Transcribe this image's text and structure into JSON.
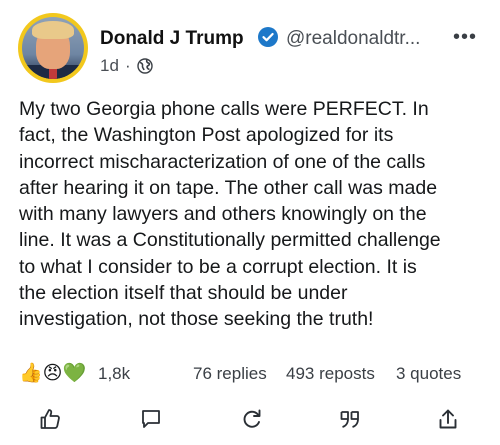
{
  "post": {
    "author": {
      "name": "Donald J Trump",
      "handle": "@realdonaldtr...",
      "verified": true,
      "avatar_icon": "avatar-portrait"
    },
    "time": "1d",
    "separator": "·",
    "visibility_icon": "globe-icon",
    "more_label": "•••",
    "body_lines": [
      "My two Georgia phone calls were PERFECT. In",
      "fact, the Washington Post apologized for its",
      "incorrect mischaracterization of one of the calls",
      "after hearing it on tape. The other call was made",
      "with many lawyers and others knowingly on the",
      "line. It was a Constitutionally permitted challenge",
      "to what I consider to be a corrupt election. It is",
      "the election itself that should be under",
      "investigation, not those seeking the truth!"
    ],
    "reactions": {
      "emojis": [
        "👍",
        "😠",
        "💚"
      ],
      "count": "1,8k"
    },
    "stats": {
      "replies": "76 replies",
      "reposts": "493 reposts",
      "quotes": "3 quotes"
    },
    "actions": [
      "like-icon",
      "comment-icon",
      "repost-icon",
      "quote-icon",
      "share-icon"
    ]
  },
  "colors": {
    "avatar_ring": "#f2c81d",
    "verified": "#1d78c9",
    "text": "#16181a",
    "muted": "#4a4f55"
  }
}
